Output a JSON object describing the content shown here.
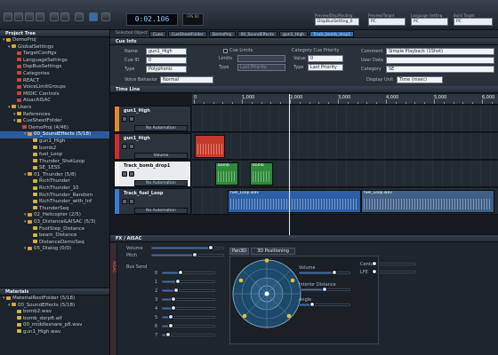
{
  "toolbar": {
    "timecode": "0:02.106",
    "fps": "FPS\n60",
    "presets": [
      {
        "label": "Preview/Disp/Routing",
        "value": "DispBusSetting_0"
      },
      {
        "label": "Preview/Target",
        "value": "PC"
      },
      {
        "label": "Language Setting",
        "value": "PC"
      },
      {
        "label": "Build Target",
        "value": "PC"
      }
    ]
  },
  "project_tree": {
    "title": "Project Tree",
    "items": [
      {
        "label": "DemoProj",
        "kind": "folder",
        "depth": 0
      },
      {
        "label": "GlobalSettings",
        "kind": "folder",
        "depth": 1
      },
      {
        "label": "TargetConfigs",
        "kind": "red",
        "depth": 2
      },
      {
        "label": "LanguageSettings",
        "kind": "red",
        "depth": 2
      },
      {
        "label": "DspBusSettings",
        "kind": "red",
        "depth": 2
      },
      {
        "label": "Categories",
        "kind": "red",
        "depth": 2
      },
      {
        "label": "REACT",
        "kind": "red",
        "depth": 2
      },
      {
        "label": "VoiceLimitGroups",
        "kind": "red",
        "depth": 2
      },
      {
        "label": "MIDIC Controls",
        "kind": "red",
        "depth": 2
      },
      {
        "label": "AisacAISAC",
        "kind": "red",
        "depth": 2
      },
      {
        "label": "Users",
        "kind": "folder",
        "depth": 1
      },
      {
        "label": "References",
        "kind": "folder",
        "depth": 2
      },
      {
        "label": "CueSheetFolder",
        "kind": "folder",
        "depth": 2
      },
      {
        "label": "DemoProj (4/46)",
        "kind": "red",
        "depth": 3
      },
      {
        "label": "00_SoundEffects (5/18)",
        "kind": "folder",
        "depth": 4,
        "selected": true
      },
      {
        "label": "gun1_High",
        "kind": "sound",
        "depth": 5
      },
      {
        "label": "bomb2",
        "kind": "sound",
        "depth": 5
      },
      {
        "label": "fuel_Loop",
        "kind": "sound",
        "depth": 5
      },
      {
        "label": "Thunder_ShotLoop",
        "kind": "sound",
        "depth": 5
      },
      {
        "label": "SE_1ESS",
        "kind": "sound",
        "depth": 5
      },
      {
        "label": "01_Thunder (5/8)",
        "kind": "folder",
        "depth": 4
      },
      {
        "label": "RichThunder",
        "kind": "sound",
        "depth": 5
      },
      {
        "label": "RichThunder_10",
        "kind": "sound",
        "depth": 5
      },
      {
        "label": "RichThunder_Random",
        "kind": "sound",
        "depth": 5
      },
      {
        "label": "RichThunder_with_Inf",
        "kind": "sound",
        "depth": 5
      },
      {
        "label": "ThunderSeq",
        "kind": "sound",
        "depth": 5
      },
      {
        "label": "02_Helicopter (2/5)",
        "kind": "folder",
        "depth": 4
      },
      {
        "label": "03_Distance&AISAC (5/3)",
        "kind": "folder",
        "depth": 4
      },
      {
        "label": "FootStep_Distance",
        "kind": "sound",
        "depth": 5
      },
      {
        "label": "beam_Distance",
        "kind": "sound",
        "depth": 5
      },
      {
        "label": "DistanceDemoSeq",
        "kind": "sound",
        "depth": 5
      },
      {
        "label": "05_Dialog (0/0)",
        "kind": "folder",
        "depth": 4
      }
    ]
  },
  "materials": {
    "title": "Materials",
    "items": [
      {
        "label": "MaterialRootFolder (5/18)",
        "kind": "folder",
        "depth": 0
      },
      {
        "label": "00_SoundEffects (5/18)",
        "kind": "folder",
        "depth": 1
      },
      {
        "label": "bomb2.wav",
        "kind": "sound",
        "depth": 2
      },
      {
        "label": "bomb_dorpft.aif",
        "kind": "sound",
        "depth": 2
      },
      {
        "label": "00_middlesnare_p8.wav",
        "kind": "sound",
        "depth": 2
      },
      {
        "label": "gun1_High.wav",
        "kind": "sound",
        "depth": 2
      }
    ]
  },
  "selbar": {
    "label": "Selected Object",
    "crumbs": [
      "Cues",
      "CueSheetFolder",
      "DemoProj",
      "00_SoundEffects",
      "gun1_High",
      "Track_bomb_drop1"
    ]
  },
  "cue_info": {
    "title": "Cue Info",
    "name_label": "Name",
    "name_value": "gun1_High",
    "cueid_label": "Cue ID",
    "cueid_value": "0",
    "type_label": "Type",
    "type_value": "Polyphonic",
    "voice_label": "Voice Behavior",
    "voice_value": "Normal",
    "cue_limits_label": "Cue Limits",
    "limits_label": "Limits",
    "limits_type_label": "Type",
    "limits_type_value": "Last Priority",
    "cat_priority_label": "Category Cue Priority",
    "value_label": "Value",
    "value_value": "0",
    "ctype_label": "Type",
    "ctype_value": "Last Priority",
    "comment_label": "Comment",
    "comment_value": "Simple Playback (1Shot)",
    "userdata_label": "User Data",
    "userdata_value": "",
    "category_label": "Category",
    "category_value": "SE",
    "display_label": "Display Unit",
    "display_value": "Time (msec)"
  },
  "timeline": {
    "title": "Time Line",
    "ruler": [
      "0",
      "1,000",
      "2,000",
      "3,000",
      "4,000",
      "5,000",
      "6,000"
    ],
    "tracks": [
      {
        "name": "gun1_High",
        "automation": "No Automation",
        "color": "#e0892f"
      },
      {
        "name": "gun1_High",
        "automation": "Volume",
        "color": "#d22c2c"
      },
      {
        "name": "Track_bomb_drop1",
        "automation": "No Automation",
        "color": "#f1f1f1"
      },
      {
        "name": "Track_fuel_Loop",
        "automation": "No Automation",
        "color": "#3a7bd5"
      }
    ],
    "clips": [
      "",
      "bomb",
      "bomb",
      "fuel_Loop.wav",
      "fuel_Loop.wav"
    ]
  },
  "fx": {
    "title": "FX / AISAC",
    "volume_label": "Volume",
    "pitch_label": "Pitch",
    "bus_label": "Bus Send",
    "bus_sends": [
      "0",
      "1",
      "2",
      "3",
      "4",
      "5",
      "6",
      "7"
    ],
    "bus_levels": [
      0.35,
      0.3,
      0.25,
      0.2,
      0.2,
      0.15,
      0.15,
      0.1
    ],
    "pan_tab": "Pan3D",
    "pos_tab": "3D Positioning",
    "center_label": "Center",
    "lfe_label": "LFE",
    "vol3d_label": "Volume",
    "interior_label": "Interior Distance",
    "angle_label": "Angle",
    "volume_level": 0.82,
    "pitch_level": 0.6,
    "vol3d_level": 0.7,
    "interior_level": 0.5,
    "angle_level": 0.25,
    "center_level": 0.0,
    "lfe_level": 0.0,
    "side_tab": "AISAC"
  }
}
